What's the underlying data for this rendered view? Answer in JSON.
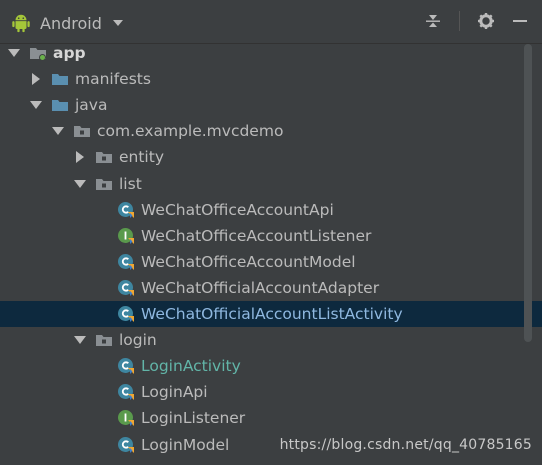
{
  "header": {
    "title": "Android",
    "colors": {
      "android_green": "#a4c639",
      "bg": "#3c3f41",
      "selected_row": "#0d293e"
    }
  },
  "tree": [
    {
      "label": "app",
      "level": 0,
      "expanded": true,
      "icon": "module-folder-icon",
      "style": "bold"
    },
    {
      "label": "manifests",
      "level": 1,
      "expanded": false,
      "icon": "folder-icon"
    },
    {
      "label": "java",
      "level": 1,
      "expanded": true,
      "icon": "folder-icon"
    },
    {
      "label": "com.example.mvcdemo",
      "level": 2,
      "expanded": true,
      "icon": "package-icon"
    },
    {
      "label": "entity",
      "level": 3,
      "expanded": false,
      "icon": "package-icon"
    },
    {
      "label": "list",
      "level": 3,
      "expanded": true,
      "icon": "package-icon"
    },
    {
      "label": "WeChatOfficeAccountApi",
      "level": 4,
      "icon": "class-icon"
    },
    {
      "label": "WeChatOfficeAccountListener",
      "level": 4,
      "icon": "interface-icon"
    },
    {
      "label": "WeChatOfficeAccountModel",
      "level": 4,
      "icon": "class-icon"
    },
    {
      "label": "WeChatOfficialAccountAdapter",
      "level": 4,
      "icon": "class-icon"
    },
    {
      "label": "WeChatOfficialAccountListActivity",
      "level": 4,
      "icon": "class-icon",
      "selected": true
    },
    {
      "label": "login",
      "level": 3,
      "expanded": true,
      "icon": "package-icon"
    },
    {
      "label": "LoginActivity",
      "level": 4,
      "icon": "class-icon",
      "style": "green"
    },
    {
      "label": "LoginApi",
      "level": 4,
      "icon": "class-icon"
    },
    {
      "label": "LoginListener",
      "level": 4,
      "icon": "interface-icon"
    },
    {
      "label": "LoginModel",
      "level": 4,
      "icon": "class-icon"
    }
  ],
  "watermark": "https://blog.csdn.net/qq_40785165"
}
